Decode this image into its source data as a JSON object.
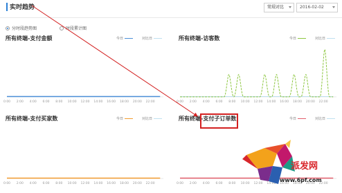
{
  "header": {
    "title": "实时趋势",
    "compare_select": "常规对比",
    "date_select": "2016-02-02"
  },
  "radios": [
    {
      "label": "分时段趋势图",
      "selected": true
    },
    {
      "label": "时段累计图",
      "selected": false
    }
  ],
  "legend": {
    "today": "今日",
    "compare": "对比日"
  },
  "colors": {
    "accent": "#2a7fd6",
    "annotation": "#d32020",
    "pay_amount": "#4a8fd8",
    "visitors": "#8cc63f",
    "buyers": "#f39c2f",
    "orders": "#e25d6a",
    "compare_line": "#bfe0f0"
  },
  "x_ticks": [
    "0:00",
    "2:00",
    "4:00",
    "6:00",
    "8:00",
    "10:00",
    "12:00",
    "14:00",
    "16:00",
    "18:00",
    "20:00",
    "22:00"
  ],
  "panels": [
    {
      "title": "所有终端-支付金额",
      "color_key": "pay_amount",
      "today_level": 0
    },
    {
      "title": "所有终端-访客数",
      "color_key": "visitors",
      "peaks": [
        {
          "x": 7.5,
          "h": 0.45
        },
        {
          "x": 9,
          "h": 0.45
        },
        {
          "x": 13,
          "h": 0.45
        },
        {
          "x": 14.8,
          "h": 0.45
        },
        {
          "x": 17.5,
          "h": 0.45
        },
        {
          "x": 19.3,
          "h": 0.45
        },
        {
          "x": 22.2,
          "h": 0.95
        }
      ]
    },
    {
      "title": "所有终端-支付买家数",
      "color_key": "buyers",
      "today_level": 0
    },
    {
      "title": "所有终端-支付子订单数",
      "color_key": "orders",
      "today_level": 0
    }
  ],
  "logo": {
    "brand": "派发网",
    "url": "www.6pf.com"
  }
}
